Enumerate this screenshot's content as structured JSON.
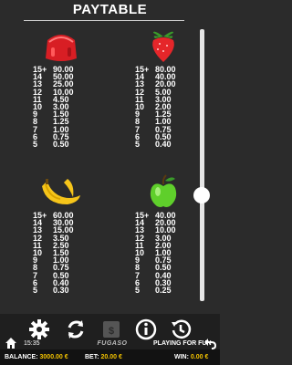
{
  "header": {
    "title": "PAYTABLE"
  },
  "paytable": {
    "strawberry_jelly": [
      [
        "15+",
        "90.00"
      ],
      [
        "14",
        "50.00"
      ],
      [
        "13",
        "25.00"
      ],
      [
        "12",
        "10.00"
      ],
      [
        "11",
        "4.50"
      ],
      [
        "10",
        "3.00"
      ],
      [
        "9",
        "1.50"
      ],
      [
        "8",
        "1.25"
      ],
      [
        "7",
        "1.00"
      ],
      [
        "6",
        "0.75"
      ],
      [
        "5",
        "0.50"
      ]
    ],
    "strawberry": [
      [
        "15+",
        "80.00"
      ],
      [
        "14",
        "40.00"
      ],
      [
        "13",
        "20.00"
      ],
      [
        "12",
        "5.00"
      ],
      [
        "11",
        "3.00"
      ],
      [
        "10",
        "2.00"
      ],
      [
        "9",
        "1.25"
      ],
      [
        "8",
        "1.00"
      ],
      [
        "7",
        "0.75"
      ],
      [
        "6",
        "0.50"
      ],
      [
        "5",
        "0.40"
      ]
    ],
    "banana": [
      [
        "15+",
        "60.00"
      ],
      [
        "14",
        "30.00"
      ],
      [
        "13",
        "15.00"
      ],
      [
        "12",
        "3.50"
      ],
      [
        "11",
        "2.50"
      ],
      [
        "10",
        "1.50"
      ],
      [
        "9",
        "1.00"
      ],
      [
        "8",
        "0.75"
      ],
      [
        "7",
        "0.50"
      ],
      [
        "6",
        "0.40"
      ],
      [
        "5",
        "0.30"
      ]
    ],
    "apple": [
      [
        "15+",
        "40.00"
      ],
      [
        "14",
        "20.00"
      ],
      [
        "13",
        "10.00"
      ],
      [
        "12",
        "3.00"
      ],
      [
        "11",
        "2.00"
      ],
      [
        "10",
        "1.00"
      ],
      [
        "9",
        "0.75"
      ],
      [
        "8",
        "0.50"
      ],
      [
        "7",
        "0.40"
      ],
      [
        "6",
        "0.30"
      ],
      [
        "5",
        "0.25"
      ]
    ]
  },
  "toolbar": {
    "brand": "FUGASO",
    "settings_icon": "gear-icon",
    "autoplay_icon": "refresh-icon",
    "cashier_icon": "wallet-icon",
    "info_icon": "info-icon",
    "history_icon": "history-icon",
    "home_icon": "home-icon",
    "back_icon": "back-arrow-icon"
  },
  "status": {
    "time": "15:35",
    "mode": "PLAYING FOR FUN",
    "balance_label": "BALANCE:",
    "balance_value": "3000.00 €",
    "bet_label": "BET:",
    "bet_value": "20.00 €",
    "win_label": "WIN:",
    "win_value": "0.00 €"
  },
  "colors": {
    "background": "#2b2b2b",
    "accent_yellow": "#f2c200",
    "jelly_red": "#d81e24",
    "strawberry_red": "#e5262a",
    "banana_yellow": "#f6c51a",
    "apple_green": "#5fcf2b"
  }
}
